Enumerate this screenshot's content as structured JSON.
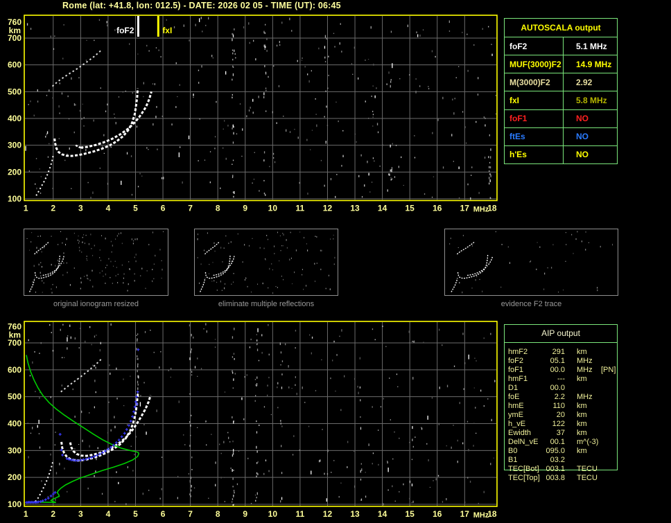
{
  "title": "Rome (lat: +41.8, lon: 012.5) - DATE: 2026 02 05 - TIME (UT): 06:45",
  "colors": {
    "axis_label": "#ffff99",
    "plot_border": "#ffff00",
    "grid": "#6b6b6b",
    "table_border": "#7ce87c",
    "profile_green": "#00cc00",
    "restored_blue": "#3a3aff",
    "caption_gray": "#9a9a9a",
    "title_yellow": "#ffff9e"
  },
  "autoscala": {
    "header": "AUTOSCALA output",
    "rows": [
      {
        "label": "foF2",
        "value": "5.1 MHz",
        "color": "#ffffff",
        "value_color": "#ffffff"
      },
      {
        "label": "MUF(3000)F2",
        "value": "14.9 MHz",
        "color": "#ffff00",
        "value_color": "#ffff00"
      },
      {
        "label": "M(3000)F2",
        "value": "2.92",
        "color": "#e8dfa0",
        "value_color": "#e8dfa0"
      },
      {
        "label": "fxI",
        "value": "5.8 MHz",
        "color": "#ffff00",
        "value_color": "#b4b400"
      },
      {
        "label": "foF1",
        "value": "NO",
        "color": "#ff2020",
        "value_color": "#ff2020"
      },
      {
        "label": "ftEs",
        "value": "NO",
        "color": "#2a7bff",
        "value_color": "#2a7bff"
      },
      {
        "label": "h'Es",
        "value": "NO",
        "color": "#ffff00",
        "value_color": "#ffff00"
      }
    ]
  },
  "aip": {
    "header": "AIP output",
    "rows": [
      {
        "label": "hmF2",
        "value": "291",
        "unit": "km",
        "extra": ""
      },
      {
        "label": "foF2",
        "value": "05.1",
        "unit": "MHz",
        "extra": ""
      },
      {
        "label": "foF1",
        "value": "00.0",
        "unit": "MHz",
        "extra": "[PN]"
      },
      {
        "label": "hmF1",
        "value": "---",
        "unit": "km",
        "extra": ""
      },
      {
        "label": "D1",
        "value": "00.0",
        "unit": "",
        "extra": ""
      },
      {
        "label": "foE",
        "value": "2.2",
        "unit": "MHz",
        "extra": ""
      },
      {
        "label": "hmE",
        "value": "110",
        "unit": "km",
        "extra": ""
      },
      {
        "label": "ymE",
        "value": "20",
        "unit": "km",
        "extra": ""
      },
      {
        "label": "h_vE",
        "value": "122",
        "unit": "km",
        "extra": ""
      },
      {
        "label": "Ewidth",
        "value": "37",
        "unit": "km",
        "extra": ""
      },
      {
        "label": "DelN_vE",
        "value": "00.1",
        "unit": "m^(-3)",
        "extra": ""
      },
      {
        "label": "B0",
        "value": "095.0",
        "unit": "km",
        "extra": ""
      },
      {
        "label": "B1",
        "value": "03.2",
        "unit": "",
        "extra": ""
      },
      {
        "label": "TEC[Bot]",
        "value": "003.1",
        "unit": "TECU",
        "extra": ""
      },
      {
        "label": "TEC[Top]",
        "value": "003.8",
        "unit": "TECU",
        "extra": ""
      }
    ]
  },
  "thumbnails": [
    {
      "caption": "original ionogram resized"
    },
    {
      "caption": "eliminate multiple reflections"
    },
    {
      "caption": "evidence F2 trace"
    }
  ],
  "chart_data": [
    {
      "type": "scatter",
      "title": "recorded ionogram (top)",
      "x_unit": "MHz",
      "y_unit": "km",
      "xlim": [
        1,
        18
      ],
      "ylim": [
        100,
        760
      ],
      "x_ticks": [
        "1",
        "2",
        "3",
        "4",
        "5",
        "6",
        "7",
        "8",
        "9",
        "10",
        "11",
        "12",
        "13",
        "14",
        "15",
        "16",
        "17",
        "18"
      ],
      "y_ticks": [
        760,
        700,
        600,
        500,
        400,
        300,
        200,
        100
      ],
      "grid": true,
      "markers": [
        {
          "label": "foF2",
          "freq": 5.1,
          "color": "#ffffff",
          "anchor": "end"
        },
        {
          "label": "fxI",
          "freq": 5.83,
          "color": "#ffff00",
          "anchor": "start"
        }
      ],
      "traces": {
        "o_trace": [
          [
            2.05,
            325
          ],
          [
            2.07,
            308
          ],
          [
            2.12,
            288
          ],
          [
            2.2,
            274
          ],
          [
            2.32,
            266
          ],
          [
            2.48,
            261
          ],
          [
            2.68,
            260
          ],
          [
            2.9,
            263
          ],
          [
            3.15,
            268
          ],
          [
            3.45,
            276
          ],
          [
            3.75,
            286
          ],
          [
            4.05,
            299
          ],
          [
            4.3,
            314
          ],
          [
            4.55,
            334
          ],
          [
            4.75,
            358
          ],
          [
            4.88,
            385
          ],
          [
            4.97,
            415
          ],
          [
            5.02,
            448
          ],
          [
            5.06,
            480
          ],
          [
            5.08,
            512
          ]
        ],
        "x_trace": [
          [
            3.0,
            291
          ],
          [
            3.25,
            294
          ],
          [
            3.55,
            301
          ],
          [
            3.85,
            311
          ],
          [
            4.15,
            324
          ],
          [
            4.45,
            341
          ],
          [
            4.75,
            363
          ],
          [
            5.0,
            388
          ],
          [
            5.2,
            414
          ],
          [
            5.38,
            443
          ],
          [
            5.5,
            472
          ],
          [
            5.58,
            500
          ]
        ],
        "spur": [
          [
            2.82,
            300
          ],
          [
            2.95,
            293
          ],
          [
            3.08,
            289
          ]
        ],
        "second_hop": [
          [
            1.97,
            520
          ],
          [
            2.08,
            530
          ],
          [
            2.22,
            542
          ],
          [
            2.4,
            555
          ],
          [
            2.6,
            568
          ],
          [
            2.82,
            582
          ],
          [
            3.05,
            598
          ],
          [
            3.28,
            615
          ],
          [
            3.5,
            632
          ],
          [
            3.68,
            648
          ],
          [
            3.78,
            658
          ]
        ],
        "e_trace": [
          [
            1.38,
            112
          ],
          [
            1.46,
            126
          ],
          [
            1.55,
            143
          ],
          [
            1.66,
            163
          ],
          [
            1.77,
            186
          ],
          [
            1.87,
            212
          ],
          [
            1.95,
            238
          ],
          [
            2.0,
            262
          ]
        ]
      }
    },
    {
      "type": "scatter",
      "title": "ionogram with restored trace and electron density profile (bottom)",
      "x_unit": "MHz",
      "y_unit": "km",
      "xlim": [
        1,
        18
      ],
      "ylim": [
        100,
        760
      ],
      "x_ticks": [
        "1",
        "2",
        "3",
        "4",
        "5",
        "6",
        "7",
        "8",
        "9",
        "10",
        "11",
        "12",
        "13",
        "14",
        "15",
        "16",
        "17",
        "18"
      ],
      "y_ticks": [
        760,
        700,
        600,
        500,
        400,
        300,
        200,
        100
      ],
      "grid": true,
      "traces": {
        "o_trace": [
          [
            2.3,
            332
          ],
          [
            2.33,
            310
          ],
          [
            2.4,
            290
          ],
          [
            2.5,
            276
          ],
          [
            2.64,
            267
          ],
          [
            2.82,
            263
          ],
          [
            3.0,
            263
          ],
          [
            3.2,
            266
          ],
          [
            3.45,
            272
          ],
          [
            3.7,
            281
          ],
          [
            3.95,
            292
          ],
          [
            4.2,
            306
          ],
          [
            4.45,
            324
          ],
          [
            4.65,
            346
          ],
          [
            4.8,
            372
          ],
          [
            4.91,
            400
          ],
          [
            4.99,
            432
          ],
          [
            5.04,
            465
          ],
          [
            5.07,
            495
          ],
          [
            5.09,
            520
          ]
        ],
        "x_trace": [
          [
            2.62,
            330
          ],
          [
            2.66,
            312
          ],
          [
            2.74,
            297
          ],
          [
            2.86,
            287
          ],
          [
            3.02,
            281
          ],
          [
            3.22,
            280
          ],
          [
            3.45,
            284
          ],
          [
            3.7,
            291
          ],
          [
            3.95,
            301
          ],
          [
            4.2,
            314
          ],
          [
            4.45,
            331
          ],
          [
            4.68,
            351
          ],
          [
            4.88,
            375
          ],
          [
            5.05,
            400
          ],
          [
            5.22,
            428
          ],
          [
            5.37,
            456
          ],
          [
            5.48,
            482
          ],
          [
            5.55,
            505
          ]
        ],
        "second_hop": [
          [
            2.28,
            518
          ],
          [
            2.4,
            528
          ],
          [
            2.55,
            540
          ],
          [
            2.72,
            553
          ],
          [
            2.9,
            566
          ],
          [
            3.1,
            582
          ],
          [
            3.3,
            598
          ],
          [
            3.5,
            615
          ],
          [
            3.68,
            632
          ],
          [
            3.8,
            645
          ]
        ],
        "e_trace": [
          [
            1.35,
            110
          ],
          [
            1.44,
            122
          ],
          [
            1.53,
            138
          ],
          [
            1.63,
            158
          ],
          [
            1.74,
            182
          ],
          [
            1.84,
            208
          ],
          [
            1.92,
            233
          ],
          [
            1.98,
            256
          ]
        ]
      },
      "profile_green": [
        [
          1.02,
          655
        ],
        [
          1.08,
          625
        ],
        [
          1.18,
          592
        ],
        [
          1.3,
          562
        ],
        [
          1.45,
          532
        ],
        [
          1.62,
          505
        ],
        [
          1.85,
          478
        ],
        [
          2.1,
          455
        ],
        [
          2.4,
          432
        ],
        [
          2.75,
          408
        ],
        [
          3.1,
          385
        ],
        [
          3.45,
          362
        ],
        [
          3.8,
          340
        ],
        [
          4.15,
          322
        ],
        [
          4.5,
          308
        ],
        [
          4.8,
          300
        ],
        [
          5.0,
          296
        ],
        [
          5.1,
          293
        ],
        [
          5.12,
          288
        ],
        [
          5.08,
          278
        ],
        [
          4.9,
          265
        ],
        [
          4.6,
          252
        ],
        [
          4.2,
          238
        ],
        [
          3.8,
          226
        ],
        [
          3.4,
          212
        ],
        [
          3.0,
          198
        ],
        [
          2.7,
          185
        ],
        [
          2.45,
          172
        ],
        [
          2.28,
          160
        ],
        [
          2.18,
          150
        ],
        [
          2.15,
          143
        ],
        [
          2.2,
          136
        ],
        [
          2.22,
          130
        ],
        [
          2.1,
          124
        ],
        [
          1.98,
          119
        ],
        [
          1.92,
          114
        ],
        [
          2.0,
          110
        ],
        [
          2.1,
          107
        ],
        [
          1.55,
          108
        ]
      ],
      "restored_trace_blue": [
        [
          1.02,
          107
        ],
        [
          1.07,
          107
        ],
        [
          1.12,
          108
        ],
        [
          1.17,
          107
        ],
        [
          1.22,
          108
        ],
        [
          1.27,
          107
        ],
        [
          1.32,
          108
        ],
        [
          1.37,
          107
        ],
        [
          1.42,
          108
        ],
        [
          1.47,
          109
        ],
        [
          1.54,
          110
        ],
        [
          1.62,
          113
        ],
        [
          1.72,
          117
        ],
        [
          1.82,
          123
        ],
        [
          1.92,
          131
        ],
        [
          2.0,
          138
        ],
        [
          2.07,
          144
        ],
        [
          2.25,
          360
        ],
        [
          2.3,
          302
        ],
        [
          2.34,
          283
        ],
        [
          2.5,
          270
        ],
        [
          2.58,
          267
        ],
        [
          2.66,
          265
        ],
        [
          2.74,
          264
        ],
        [
          2.82,
          263
        ],
        [
          2.9,
          263
        ],
        [
          3.0,
          264
        ],
        [
          3.1,
          266
        ],
        [
          3.2,
          268
        ],
        [
          3.3,
          271
        ],
        [
          3.4,
          274
        ],
        [
          3.5,
          278
        ],
        [
          3.6,
          282
        ],
        [
          3.7,
          287
        ],
        [
          3.8,
          292
        ],
        [
          3.9,
          298
        ],
        [
          4.0,
          305
        ],
        [
          4.1,
          312
        ],
        [
          4.2,
          320
        ],
        [
          4.3,
          329
        ],
        [
          4.4,
          339
        ],
        [
          4.5,
          351
        ],
        [
          4.6,
          364
        ],
        [
          4.68,
          378
        ],
        [
          4.76,
          393
        ],
        [
          4.83,
          409
        ],
        [
          4.89,
          426
        ],
        [
          4.94,
          444
        ],
        [
          4.98,
          462
        ],
        [
          5.01,
          481
        ],
        [
          5.04,
          500
        ],
        [
          5.05,
          473
        ],
        [
          5.08,
          518
        ],
        [
          5.1,
          675
        ]
      ]
    }
  ],
  "decor": {
    "noise_top": {
      "seed": 7,
      "count": 340,
      "columns": [
        [
          8.55,
          26,
          100,
          760
        ],
        [
          9.7,
          20,
          100,
          760
        ],
        [
          11.9,
          10,
          100,
          760
        ],
        [
          14.3,
          10,
          100,
          760
        ],
        [
          17.9,
          14,
          100,
          330
        ]
      ]
    },
    "noise_bottom": {
      "seed": 13,
      "count": 340,
      "columns": [
        [
          5.05,
          18,
          430,
          760
        ],
        [
          7.0,
          20,
          100,
          760
        ],
        [
          8.55,
          26,
          100,
          760
        ],
        [
          9.4,
          16,
          100,
          760
        ],
        [
          10.3,
          12,
          100,
          760
        ],
        [
          13.2,
          10,
          100,
          760
        ],
        [
          15.1,
          10,
          100,
          760
        ]
      ]
    },
    "thumb_seeds": [
      21,
      22,
      23
    ],
    "thumb_counts": [
      140,
      100,
      45
    ]
  }
}
